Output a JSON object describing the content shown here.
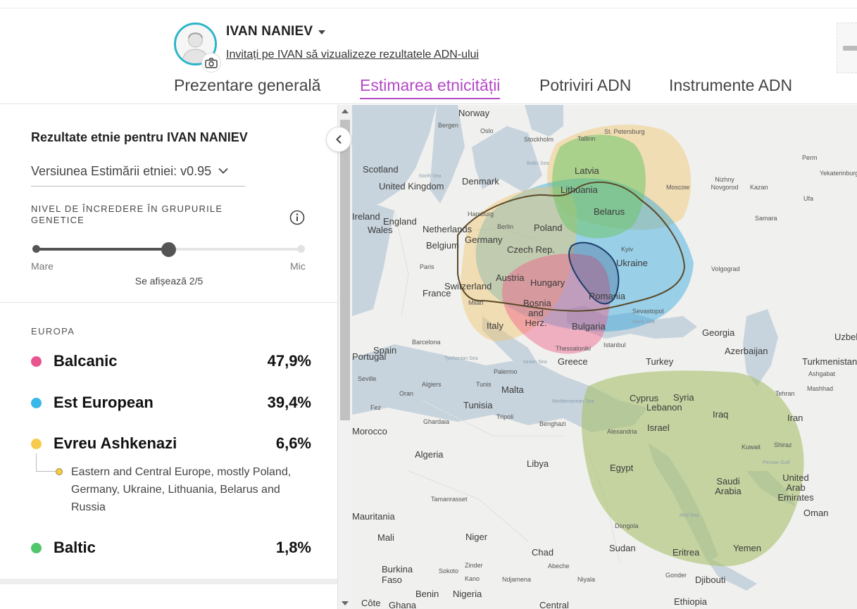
{
  "header": {
    "username": "IVAN NANIEV",
    "invite_link": "Invitați pe IVAN să vizualizeze rezultatele ADN-ului",
    "tabs": [
      {
        "label": "Prezentare generală",
        "active": false
      },
      {
        "label": "Estimarea etnicității",
        "active": true
      },
      {
        "label": "Potriviri ADN",
        "active": false
      },
      {
        "label": "Instrumente ADN",
        "active": false
      }
    ]
  },
  "panel": {
    "title": "Rezultate etnie pentru IVAN NANIEV",
    "version_label": "Versiunea Estimării etniei: v0.95",
    "confidence_label": "NIVEL DE ÎNCREDERE ÎN GRUPURILE GENETICE",
    "slider": {
      "min_label": "Mare",
      "max_label": "Mic",
      "status": "Se afișează 2/5",
      "position": 0.5
    },
    "region_label": "EUROPA",
    "ethnicities": [
      {
        "name": "Balcanic",
        "percent": "47,9%",
        "color": "#e8548e"
      },
      {
        "name": "Est European",
        "percent": "39,4%",
        "color": "#38b8e8"
      },
      {
        "name": "Evreu Ashkenazi",
        "percent": "6,6%",
        "color": "#f6cb4b",
        "sub": "Eastern and Central Europe, mostly Poland, Germany, Ukraine, Lithuania, Belarus and Russia"
      },
      {
        "name": "Baltic",
        "percent": "1,8%",
        "color": "#52c66a"
      }
    ]
  },
  "map": {
    "countries": [
      "Norway",
      "Scotland",
      "United Kingdom",
      "Denmark",
      "Ireland",
      "England",
      "Wales",
      "Netherlands",
      "Belgium",
      "Germany",
      "Poland",
      "Czech Rep.",
      "France",
      "Switzerland",
      "Austria",
      "Hungary",
      "Romania",
      "Ukraine",
      "Belarus",
      "Lithuania",
      "Latvia",
      "Bosnia and Herz.",
      "Bulgaria",
      "Italy",
      "Spain",
      "Portugal",
      "Greece",
      "Turkey",
      "Georgia",
      "Azerbaijan",
      "Turkmenistan",
      "Uzbekistan",
      "Cyprus",
      "Syria",
      "Lebanon",
      "Israel",
      "Iraq",
      "Iran",
      "Kuwait",
      "Egypt",
      "Saudi Arabia",
      "United Arab Emirates",
      "Oman",
      "Yemen",
      "Sudan",
      "Eritrea",
      "Djibouti",
      "Ethiopia",
      "Libya",
      "Algeria",
      "Tunisia",
      "Malta",
      "Morocco",
      "Mali",
      "Niger",
      "Chad",
      "Burkina Faso",
      "Benin",
      "Nigeria",
      "Côte",
      "Ghana",
      "Central",
      "Mauritania"
    ],
    "cities": [
      "Bergen",
      "Oslo",
      "Stockholm",
      "Tallinn",
      "St. Petersburg",
      "Moscow",
      "Nizhny Novgorod",
      "Kazan",
      "Perm",
      "Yekaterinburg",
      "Ufa",
      "Samara",
      "Volgograd",
      "Kyiv",
      "Sevastopol",
      "Hamburg",
      "Berlin",
      "Paris",
      "Milan",
      "Barcelona",
      "Seville",
      "Algiers",
      "Tunis",
      "Palermo",
      "Oran",
      "Fez",
      "Ghardaia",
      "Tripoli",
      "Benghazi",
      "Istanbul",
      "Thessaloniki",
      "Ashgabat",
      "Mashhad",
      "Tehran",
      "Shiraz",
      "Alexandria",
      "Tamanrasset",
      "Dongola",
      "Zinder",
      "Sokoto",
      "Kano",
      "Abeche",
      "Ndjamena",
      "Niyala",
      "Gonder"
    ],
    "waters": [
      "North Sea",
      "Baltic Sea",
      "Black Sea",
      "Tyrrhenian Sea",
      "Mediterranean Sea",
      "Ionian Sea",
      "Persian Gulf",
      "Red Sea"
    ]
  }
}
